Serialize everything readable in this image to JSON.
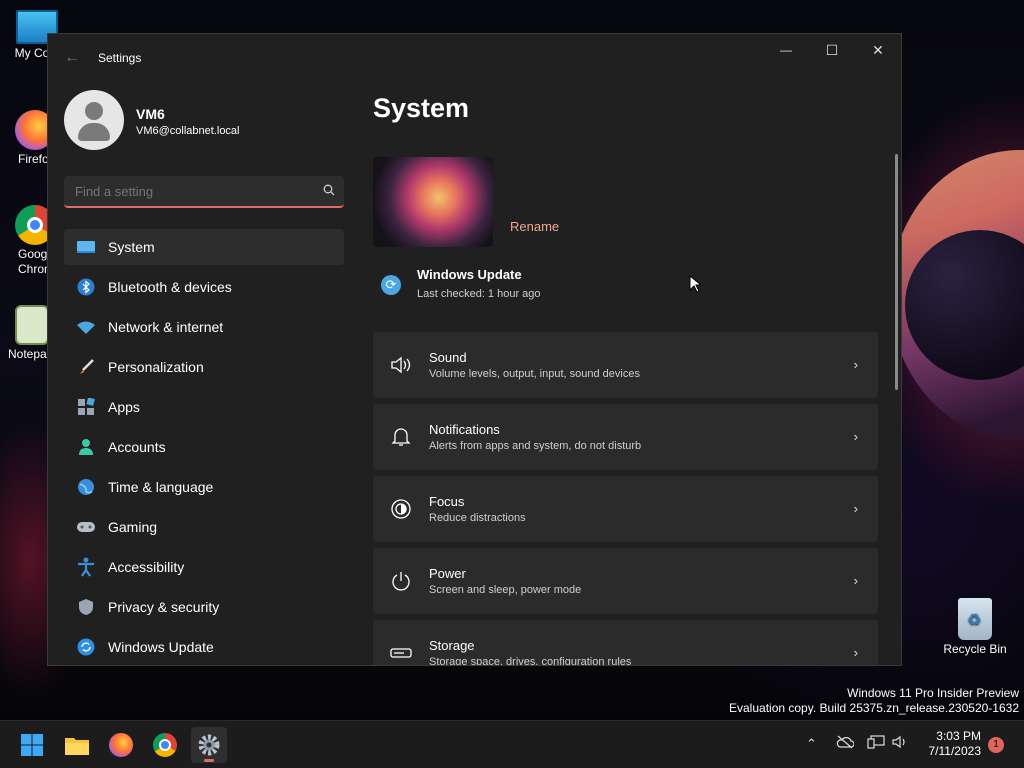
{
  "desktop": {
    "icons": [
      {
        "label": "My Com",
        "name": "my-computer"
      },
      {
        "label": "Firefo",
        "name": "firefox"
      },
      {
        "label": "Goog\nChron",
        "name": "google-chrome"
      },
      {
        "label": "Notepa",
        "name": "notepad"
      }
    ],
    "recycle_bin": "Recycle Bin",
    "watermark_line1": "Windows 11 Pro Insider Preview",
    "watermark_line2": "Evaluation copy. Build 25375.zn_release.230520-1632"
  },
  "window": {
    "title": "Settings",
    "minimize": "—",
    "maximize": "☐",
    "close": "✕"
  },
  "user": {
    "name": "VM6",
    "email": "VM6@collabnet.local"
  },
  "search": {
    "placeholder": "Find a setting"
  },
  "sidebar": {
    "items": [
      {
        "label": "System",
        "icon": "monitor-icon"
      },
      {
        "label": "Bluetooth & devices",
        "icon": "bluetooth-icon"
      },
      {
        "label": "Network & internet",
        "icon": "wifi-icon"
      },
      {
        "label": "Personalization",
        "icon": "brush-icon"
      },
      {
        "label": "Apps",
        "icon": "apps-icon"
      },
      {
        "label": "Accounts",
        "icon": "person-icon"
      },
      {
        "label": "Time & language",
        "icon": "globe-icon"
      },
      {
        "label": "Gaming",
        "icon": "gamepad-icon"
      },
      {
        "label": "Accessibility",
        "icon": "accessibility-icon"
      },
      {
        "label": "Privacy & security",
        "icon": "shield-icon"
      },
      {
        "label": "Windows Update",
        "icon": "update-icon"
      }
    ]
  },
  "main": {
    "title": "System",
    "rename": "Rename",
    "windows_update": {
      "title": "Windows Update",
      "status": "Last checked: 1 hour ago"
    },
    "cards": [
      {
        "title": "Sound",
        "subtitle": "Volume levels, output, input, sound devices",
        "icon": "speaker-icon"
      },
      {
        "title": "Notifications",
        "subtitle": "Alerts from apps and system, do not disturb",
        "icon": "bell-icon"
      },
      {
        "title": "Focus",
        "subtitle": "Reduce distractions",
        "icon": "focus-icon"
      },
      {
        "title": "Power",
        "subtitle": "Screen and sleep, power mode",
        "icon": "power-icon"
      },
      {
        "title": "Storage",
        "subtitle": "Storage space, drives, configuration rules",
        "icon": "storage-icon"
      }
    ]
  },
  "taskbar": {
    "time": "3:03 PM",
    "date": "7/11/2023",
    "notification_count": "1"
  },
  "colors": {
    "accent": "#e06c6c",
    "window_bg": "#202020",
    "card_bg": "#2b2b2b",
    "rename_link": "#f1a78c"
  }
}
